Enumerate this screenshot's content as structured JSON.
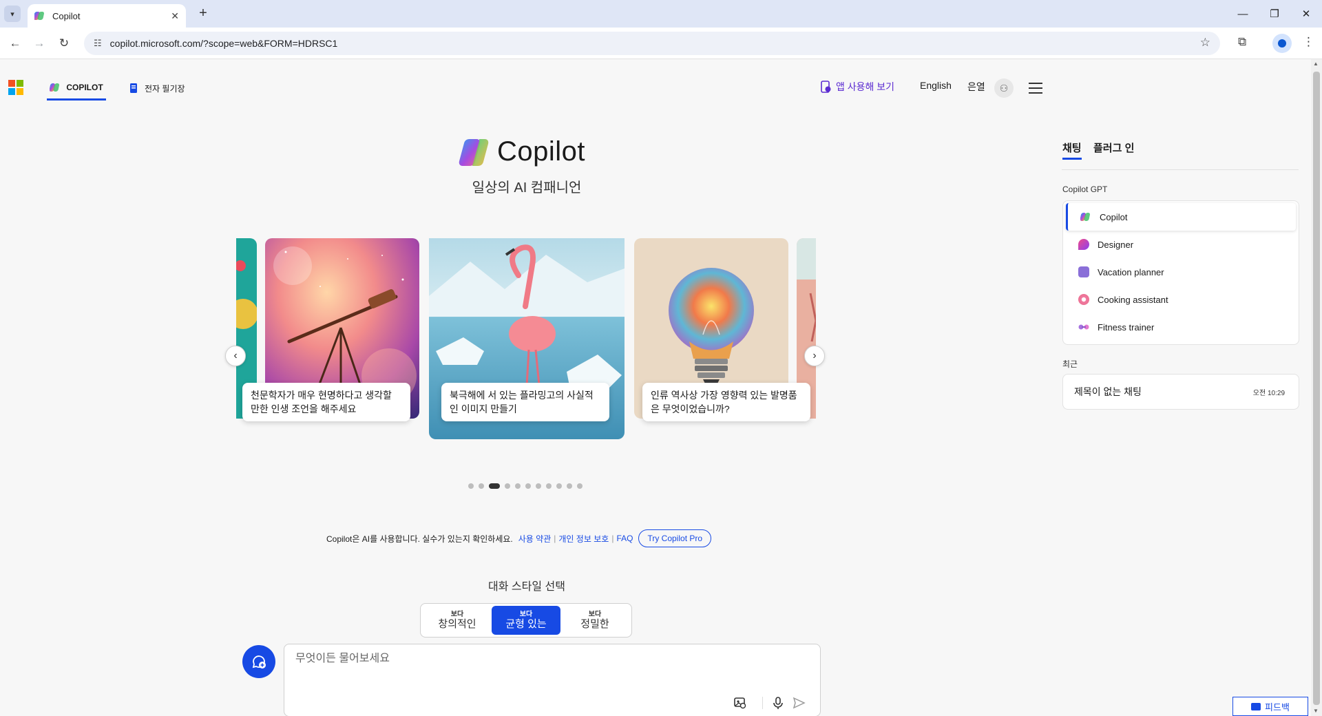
{
  "browser": {
    "tab_title": "Copilot",
    "url": "copilot.microsoft.com/?scope=web&FORM=HDRSC1"
  },
  "header": {
    "tabs": [
      {
        "label": "COPILOT",
        "active": true
      },
      {
        "label": "전자 필기장",
        "active": false
      }
    ],
    "app_link": "앱 사용해 보기",
    "language": "English",
    "user_name": "은열"
  },
  "hero": {
    "title": "Copilot",
    "tagline": "일상의 AI 컴패니언"
  },
  "carousel": {
    "cards": [
      {
        "caption": "천문학자가 매우 현명하다고 생각할 만한 인생 조언을 해주세요"
      },
      {
        "caption": "북극해에 서 있는 플라밍고의 사실적인 이미지 만들기"
      },
      {
        "caption": "인류 역사상 가장 영향력 있는 발명품은 무엇이었습니까?"
      }
    ],
    "dot_count": 11,
    "active_dot": 2
  },
  "disclaimer": {
    "text": "Copilot은 AI를 사용합니다. 실수가 있는지 확인하세요.",
    "links": [
      "사용 약관",
      "개인 정보 보호",
      "FAQ"
    ],
    "pro_button": "Try Copilot Pro"
  },
  "style_selector": {
    "label": "대화 스타일 선택",
    "options": [
      {
        "small": "보다",
        "main": "창의적인",
        "active": false
      },
      {
        "small": "보다",
        "main": "균형 있는",
        "active": true
      },
      {
        "small": "보다",
        "main": "정밀한",
        "active": false
      }
    ]
  },
  "input": {
    "placeholder": "무엇이든 물어보세요"
  },
  "feedback_label": "피드백",
  "right_panel": {
    "tabs": [
      {
        "label": "채팅",
        "active": true
      },
      {
        "label": "플러그 인",
        "active": false
      }
    ],
    "gpt_section_label": "Copilot GPT",
    "gpts": [
      {
        "name": "Copilot",
        "active": true,
        "icon": "copilot-icon"
      },
      {
        "name": "Designer",
        "active": false,
        "icon": "designer-icon"
      },
      {
        "name": "Vacation planner",
        "active": false,
        "icon": "suitcase-icon"
      },
      {
        "name": "Cooking assistant",
        "active": false,
        "icon": "donut-icon"
      },
      {
        "name": "Fitness trainer",
        "active": false,
        "icon": "dumbbell-icon"
      }
    ],
    "recent_label": "최근",
    "recent": [
      {
        "title": "제목이 없는 채팅",
        "time": "오전 10:29"
      }
    ]
  },
  "colors": {
    "accent": "#174ae4",
    "app_link": "#5b2bd1"
  }
}
